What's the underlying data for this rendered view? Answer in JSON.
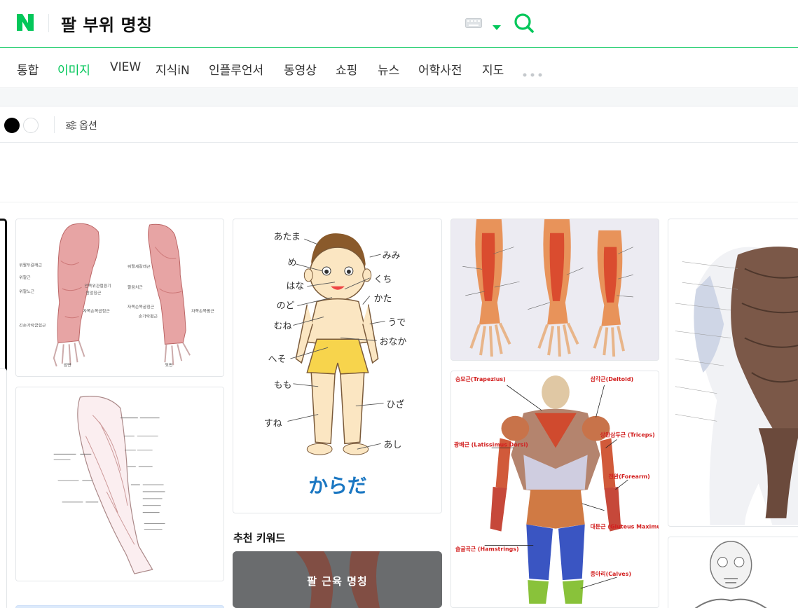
{
  "header": {
    "logo_text": "N",
    "query": "팔 부위 명칭",
    "icons": [
      "naver-logo-icon",
      "keyboard-icon",
      "caret-down-icon",
      "search-icon"
    ]
  },
  "tabs": [
    {
      "label": "통합",
      "active": false
    },
    {
      "label": "이미지",
      "active": true
    },
    {
      "label": "VIEW",
      "active": false
    },
    {
      "label": "지식iN",
      "active": false
    },
    {
      "label": "인플루언서",
      "active": false
    },
    {
      "label": "동영상",
      "active": false
    },
    {
      "label": "쇼핑",
      "active": false
    },
    {
      "label": "뉴스",
      "active": false
    },
    {
      "label": "어학사전",
      "active": false
    },
    {
      "label": "지도",
      "active": false
    }
  ],
  "options": {
    "label": "옵션",
    "swatches": [
      "#000000",
      "#ffffff"
    ]
  },
  "colors": {
    "brand": "#03c75a",
    "text": "#222222"
  },
  "images": {
    "arm_front_back": {
      "labels_left": [
        "위팔두갈래근",
        "위팔근",
        "위팔노근",
        "긴손가락굽힘근"
      ],
      "labels_mid": [
        "안쪽위관절융기",
        "원엎침근",
        "자쪽손목굽힘근"
      ],
      "labels_right": [
        "위팔세갈래근",
        "팔꿈치근",
        "자쪽손목굽힘근",
        "손가락폄근",
        "자쪽손목폄근"
      ],
      "captions": [
        "앞면",
        "뒷면"
      ]
    },
    "karada": {
      "labels": [
        "あたま",
        "め",
        "はな",
        "のど",
        "むね",
        "へそ",
        "もも",
        "すね",
        "みみ",
        "くち",
        "かた",
        "うで",
        "おなか",
        "ひざ",
        "あし"
      ],
      "title": "からだ"
    },
    "back_muscles": {
      "labels": [
        "승모근(Trapezius)",
        "삼각근(Deltoid)",
        "광배근 (Latissimus Dorsi)",
        "상완삼두근 (Triceps)",
        "전완(Forearm)",
        "대둔근 (Gluteus Maximus)",
        "슬굴곡근 (Hamstrings)",
        "종아리(Calves)"
      ]
    }
  },
  "recommended": {
    "title": "추천 키워드",
    "keyword": "팔 근육 명칭"
  }
}
